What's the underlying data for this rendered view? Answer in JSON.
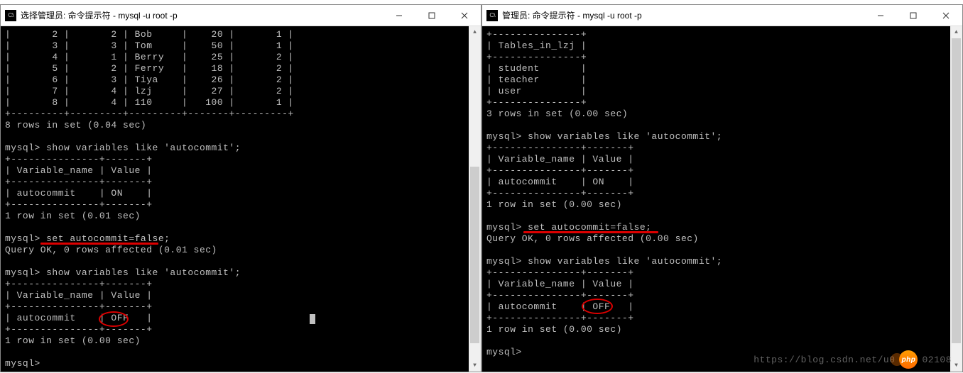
{
  "left": {
    "title": "选择管理员: 命令提示符 - mysql  -u root -p",
    "icon_label": "C:\\",
    "terminal": {
      "data_rows": [
        {
          "a": "2",
          "b": "2",
          "name": "Bob",
          "c": "20",
          "d": "1"
        },
        {
          "a": "3",
          "b": "3",
          "name": "Tom",
          "c": "50",
          "d": "1"
        },
        {
          "a": "4",
          "b": "1",
          "name": "Berry",
          "c": "25",
          "d": "2"
        },
        {
          "a": "5",
          "b": "2",
          "name": "Ferry",
          "c": "18",
          "d": "2"
        },
        {
          "a": "6",
          "b": "3",
          "name": "Tiya",
          "c": "26",
          "d": "2"
        },
        {
          "a": "7",
          "b": "4",
          "name": "lzj",
          "c": "27",
          "d": "2"
        },
        {
          "a": "8",
          "b": "4",
          "name": "110",
          "c": "100",
          "d": "1"
        }
      ],
      "rows_msg": "8 rows in set (0.04 sec)",
      "prompt": "mysql>",
      "cmd1": "show variables like 'autocommit';",
      "var_header1": "Variable_name",
      "var_header2": "Value",
      "var1_name": "autocommit",
      "var1_value": "ON",
      "row1_msg": "1 row in set (0.01 sec)",
      "cmd2": "set autocommit=false;",
      "ok_msg": "Query OK, 0 rows affected (0.01 sec)",
      "cmd3": "show variables like 'autocommit';",
      "var2_name": "autocommit",
      "var2_value": "OFF",
      "row2_msg": "1 row in set (0.00 sec)"
    }
  },
  "right": {
    "title": "管理员: 命令提示符 - mysql  -u root -p",
    "icon_label": "C:\\",
    "terminal": {
      "sep": "+---------------+",
      "tables_header": "Tables_in_lzj",
      "tables": [
        "student",
        "teacher",
        "user"
      ],
      "rows_msg": "3 rows in set (0.00 sec)",
      "prompt": "mysql>",
      "cmd1": "show variables like 'autocommit';",
      "var_header1": "Variable_name",
      "var_header2": "Value",
      "var1_name": "autocommit",
      "var1_value": "ON",
      "row1_msg": "1 row in set (0.00 sec)",
      "cmd2": "set autocommit=false;",
      "ok_msg": "Query OK, 0 rows affected (0.00 sec)",
      "cmd3": "show variables like 'autocommit';",
      "var2_name": "autocommit",
      "var2_value": "OFF",
      "row2_msg": "1 row in set (0.00 sec)"
    }
  },
  "watermark": "https://blog.csdn.net/u0",
  "watermark_tail": "02108",
  "php": "php"
}
